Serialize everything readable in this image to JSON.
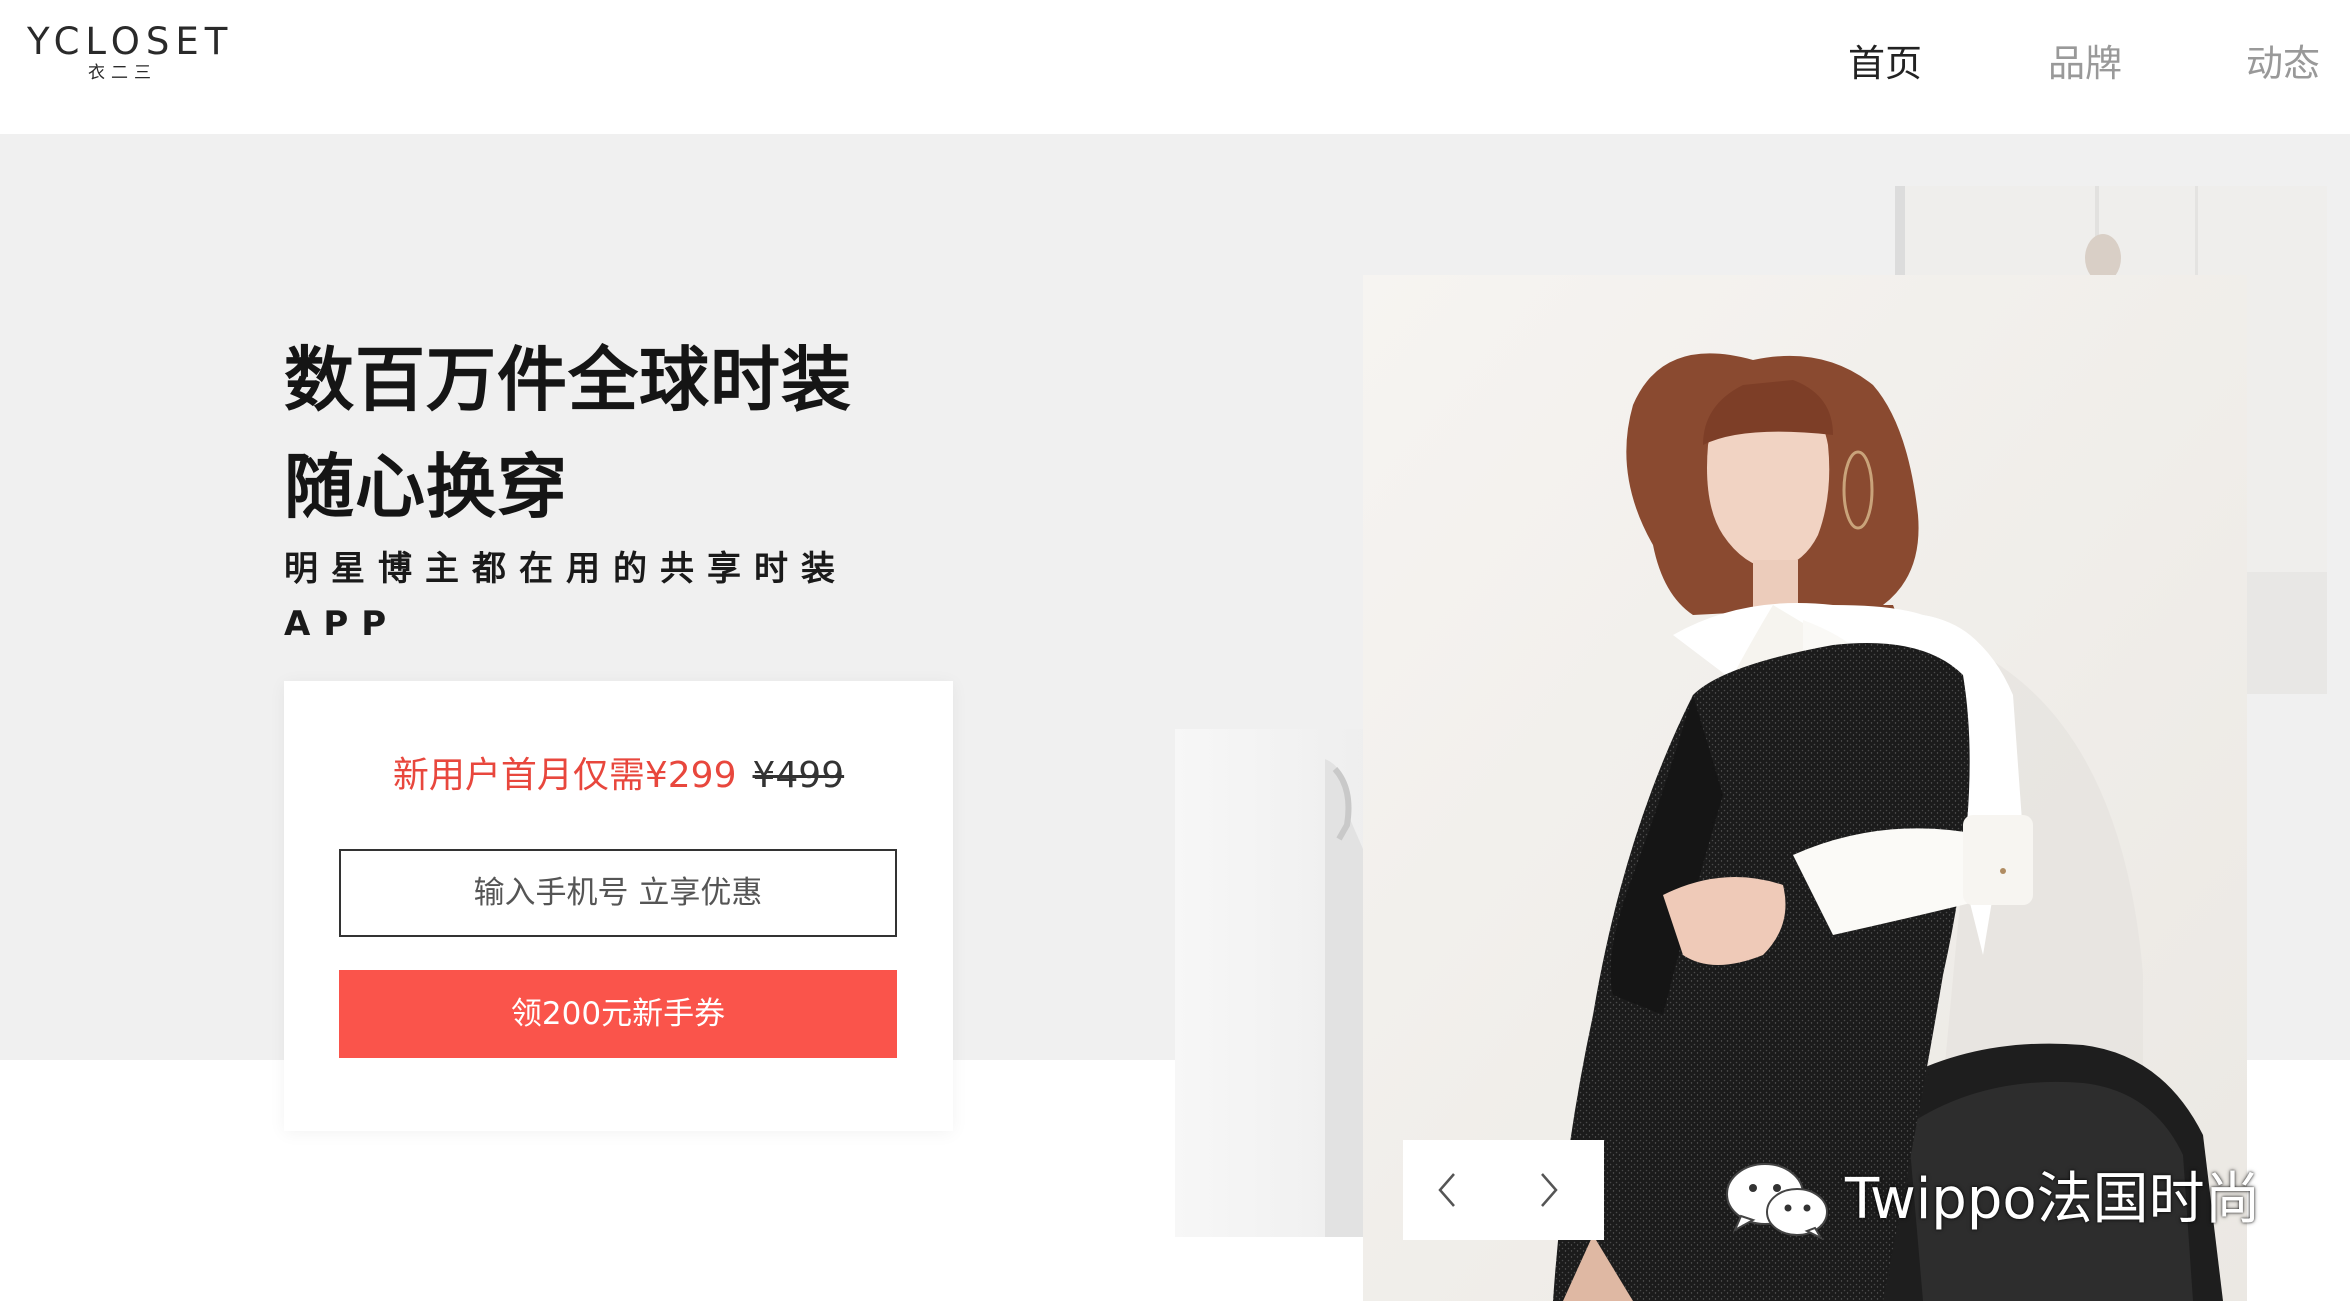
{
  "brand": {
    "logo_main": "YCLOSET",
    "logo_sub": "衣二三"
  },
  "nav": {
    "items": [
      {
        "label": "首页",
        "active": true
      },
      {
        "label": "品牌"
      },
      {
        "label": "动态"
      }
    ]
  },
  "hero": {
    "headline_1": "数百万件全球时装",
    "headline_2": "随心换穿",
    "sub_1": "明星博主都在用的共享时装",
    "sub_2": "APP"
  },
  "promo": {
    "new_price_text": "新用户首月仅需¥299",
    "old_price_text": "¥499",
    "phone_placeholder": "输入手机号 立享优惠",
    "button_label": "领200元新手券",
    "accent_color": "#fa544b"
  },
  "slider": {
    "prev_icon": "chevron-left-icon",
    "next_icon": "chevron-right-icon"
  },
  "watermark": {
    "icon": "wechat-icon",
    "text": "Twippo法国时尚"
  }
}
